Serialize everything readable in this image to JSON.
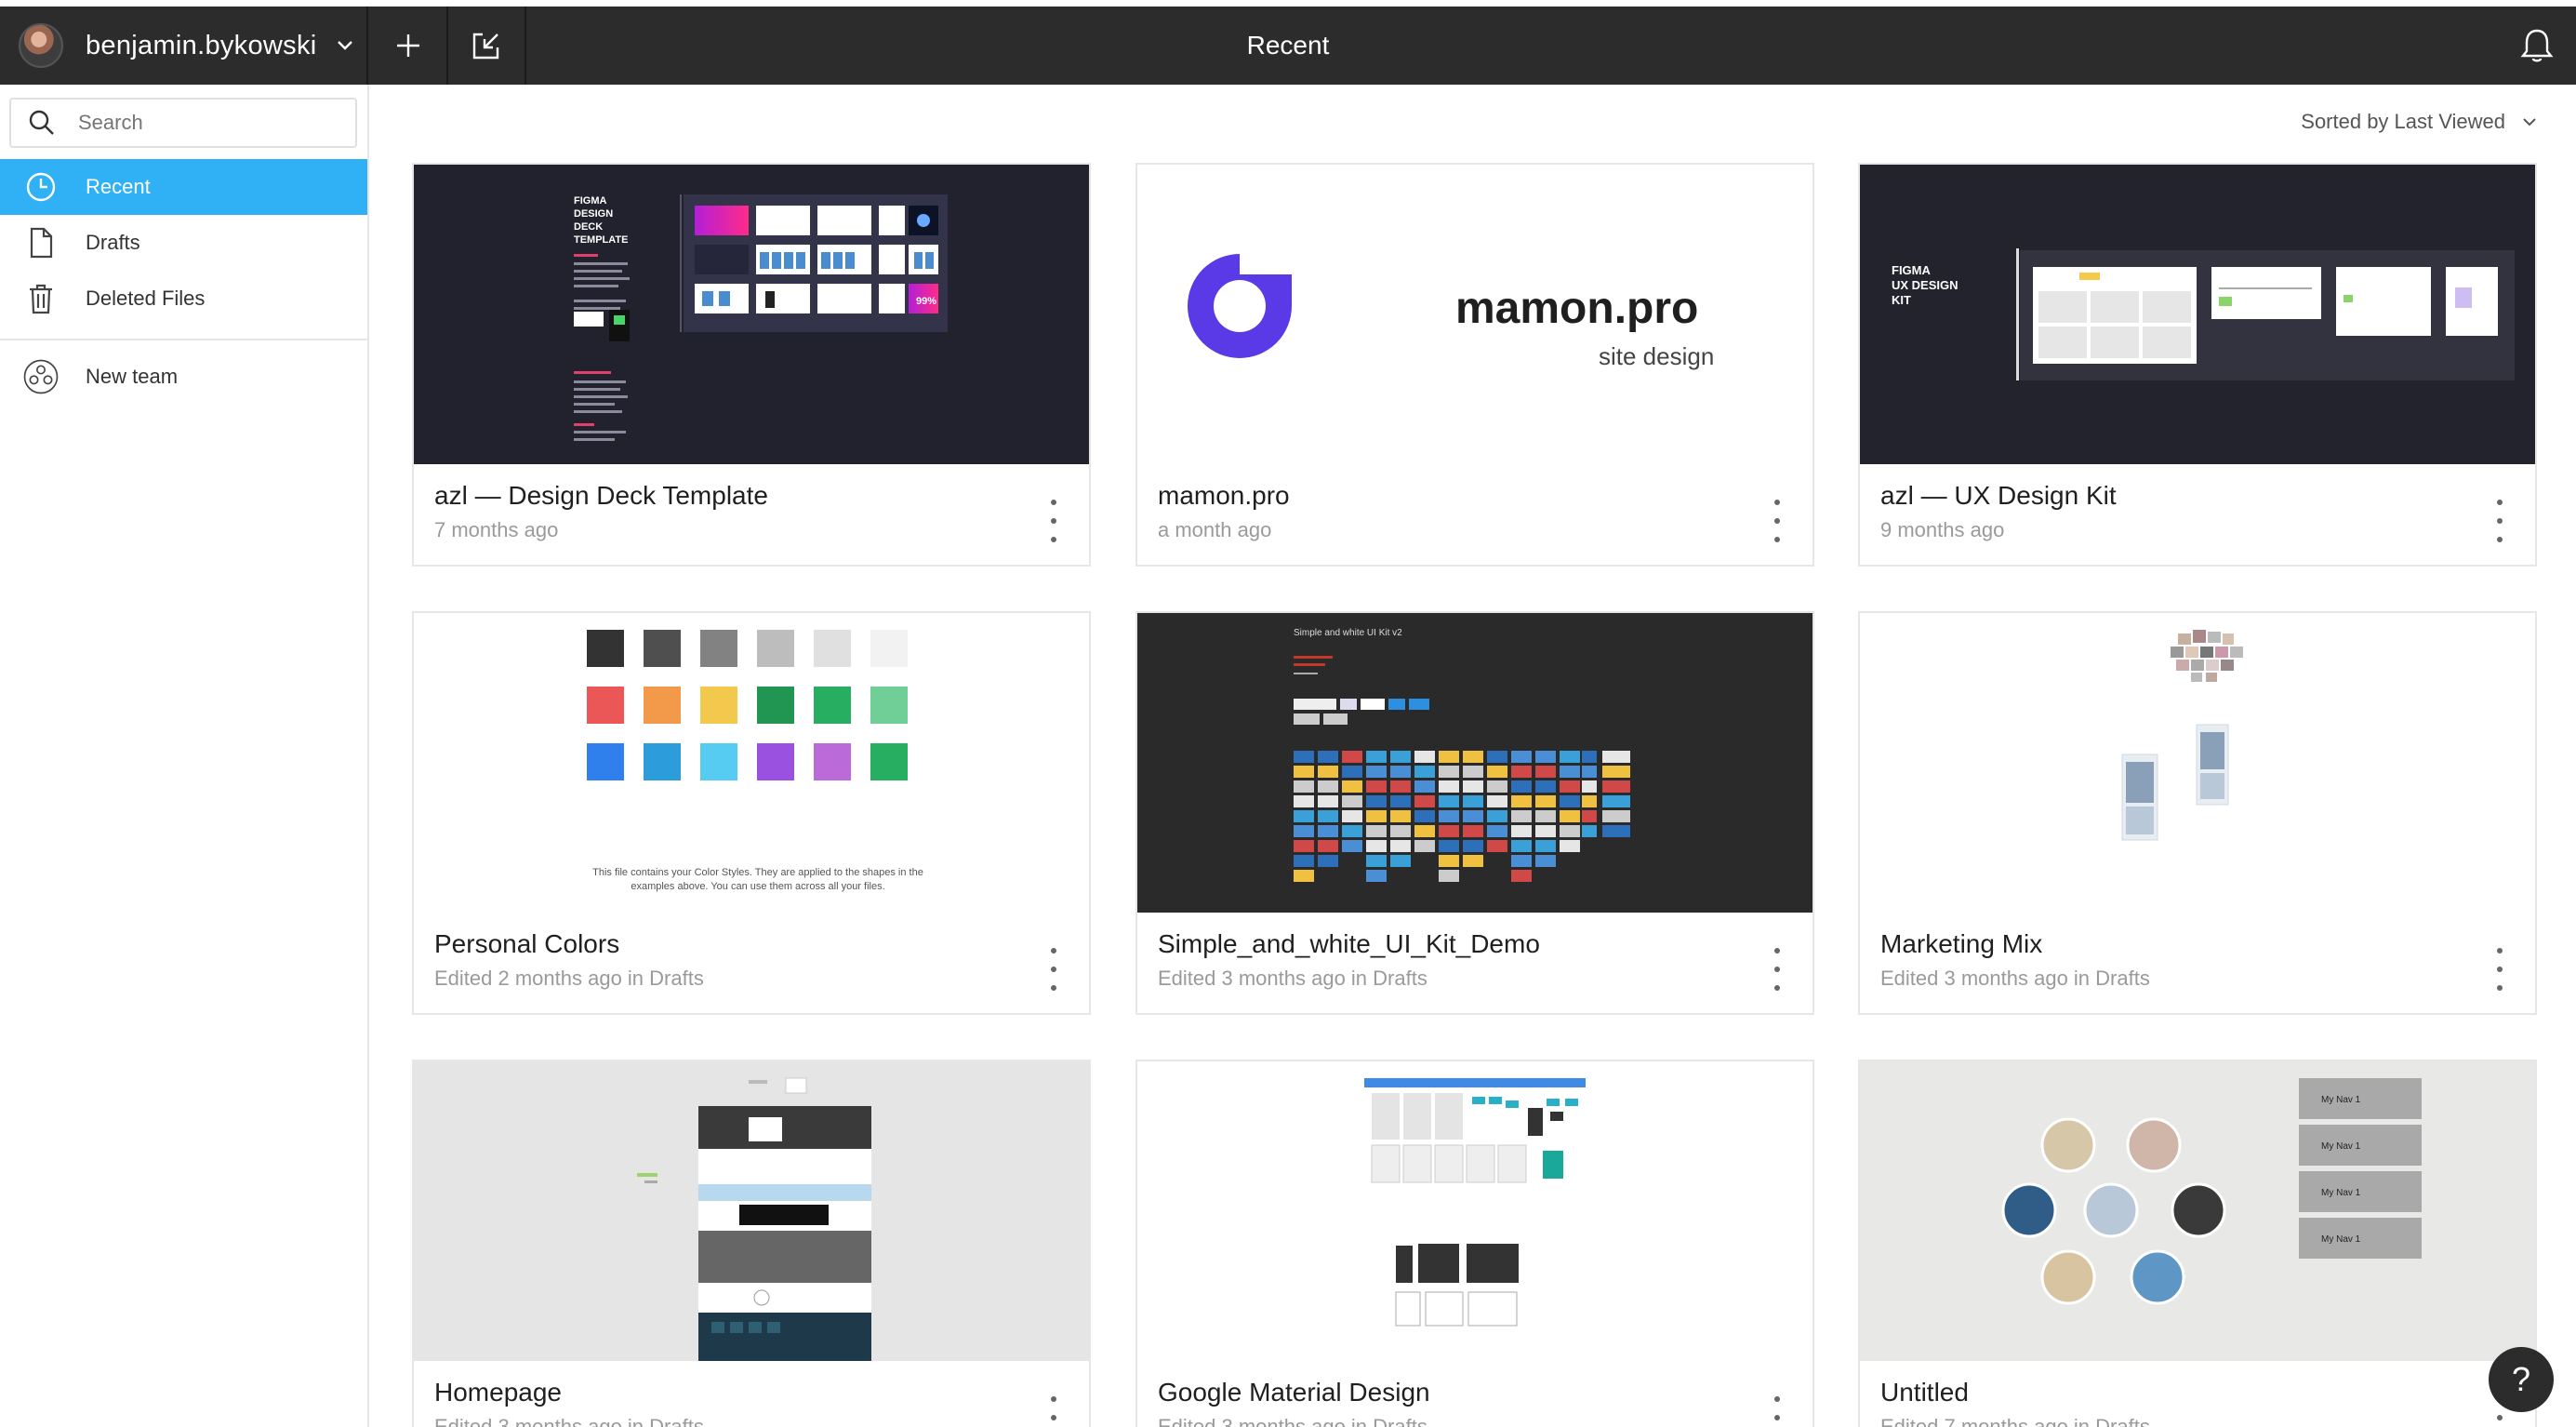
{
  "header": {
    "username": "benjamin.bykowski",
    "title": "Recent"
  },
  "sidebar": {
    "search_placeholder": "Search",
    "items": [
      {
        "label": "Recent",
        "icon": "clock-icon",
        "active": true
      },
      {
        "label": "Drafts",
        "icon": "file-icon",
        "active": false
      },
      {
        "label": "Deleted Files",
        "icon": "trash-icon",
        "active": false
      }
    ],
    "team": {
      "label": "New team",
      "icon": "team-icon"
    }
  },
  "main": {
    "sort_label": "Sorted by Last Viewed",
    "files": [
      {
        "title": "azl — Design Deck Template",
        "subtitle": "7 months ago",
        "thumb": "deck"
      },
      {
        "title": "mamon.pro",
        "subtitle": "a month ago",
        "thumb": "logo"
      },
      {
        "title": "azl — UX Design Kit",
        "subtitle": "9 months ago",
        "thumb": "uxkit"
      },
      {
        "title": "Personal Colors",
        "subtitle": "Edited 2 months ago in Drafts",
        "thumb": "colors"
      },
      {
        "title": "Simple_and_white_UI_Kit_Demo",
        "subtitle": "Edited 3 months ago in Drafts",
        "thumb": "uikit"
      },
      {
        "title": "Marketing Mix",
        "subtitle": "Edited 3 months ago in Drafts",
        "thumb": "marketing"
      },
      {
        "title": "Homepage",
        "subtitle": "Edited 3 months ago in Drafts",
        "thumb": "homepage"
      },
      {
        "title": "Google Material Design",
        "subtitle": "Edited 3 months ago in Drafts",
        "thumb": "material"
      },
      {
        "title": "Untitled",
        "subtitle": "Edited 7 months ago in Drafts",
        "thumb": "untitled"
      }
    ],
    "thumb_text": {
      "deck_title": "FIGMA DESIGN DECK TEMPLATE",
      "deck_pct": "99%",
      "logo_name": "mamon.pro",
      "logo_tag": "site design",
      "uxkit_title": "FIGMA UX DESIGN KIT",
      "colors_note": "This file contains your Color Styles. They are applied to the shapes in the examples above. You can use them across all your files.",
      "uikit_title": "Simple and white UI Kit v2",
      "nav_label": "My Nav 1"
    },
    "palette": [
      "#333333",
      "#4f4f4f",
      "#828282",
      "#bdbdbd",
      "#e0e0e0",
      "#f2f2f2",
      "#eb5757",
      "#f2994a",
      "#f2c94c",
      "#219653",
      "#27ae60",
      "#6fcf97",
      "#2f80ed",
      "#2d9cdb",
      "#56ccf2",
      "#9b51e0",
      "#bb6bd9",
      "#27ae60"
    ]
  },
  "colors": {
    "topbar": "#2c2c2c",
    "accent": "#30b1f5",
    "deck_bg": "#22222f",
    "uikit_bg": "#2a2a2a"
  },
  "help_label": "?"
}
